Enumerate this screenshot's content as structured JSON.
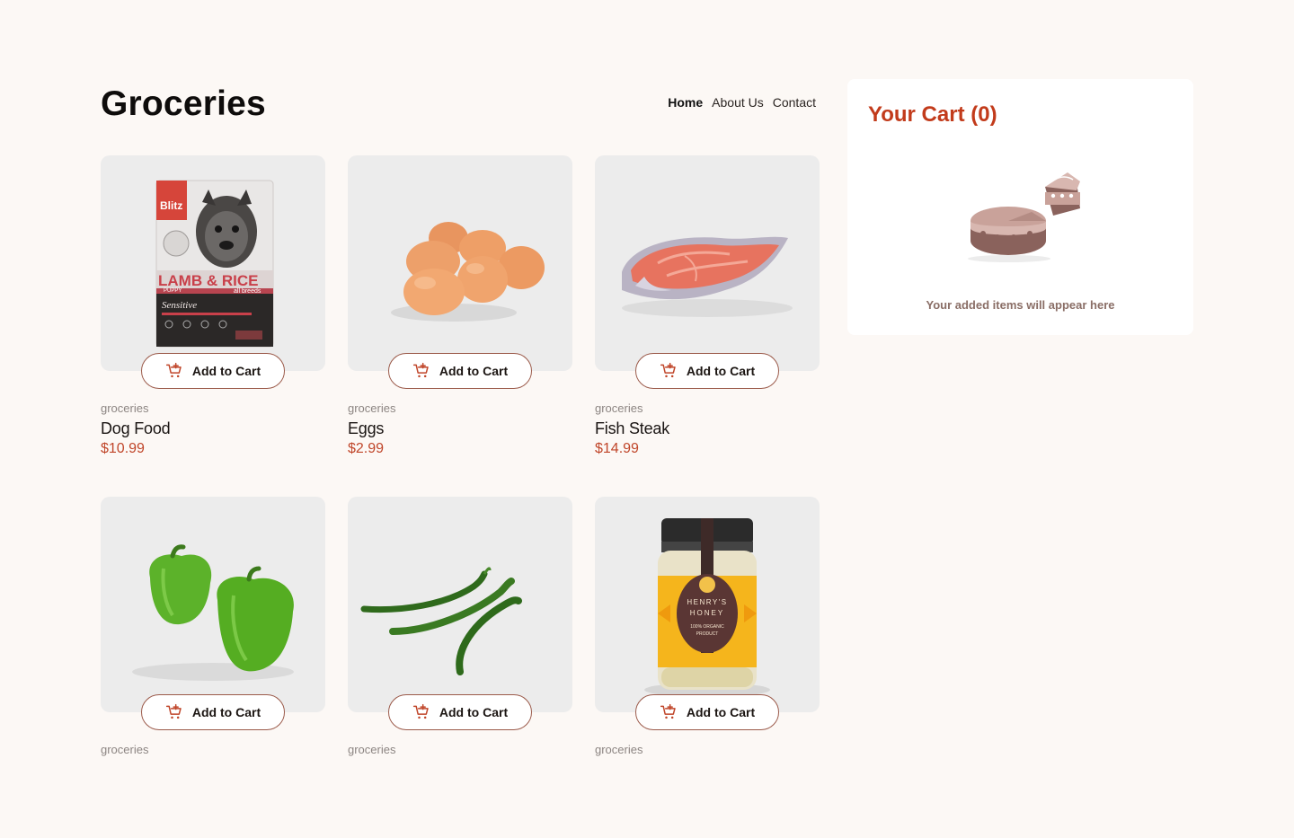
{
  "header": {
    "title": "Groceries",
    "nav": [
      {
        "label": "Home",
        "active": true
      },
      {
        "label": "About Us",
        "active": false
      },
      {
        "label": "Contact",
        "active": false
      }
    ]
  },
  "products": [
    {
      "category": "groceries",
      "name": "Dog Food",
      "price": "$10.99",
      "button": "Add to Cart",
      "image": "dog-food-bag"
    },
    {
      "category": "groceries",
      "name": "Eggs",
      "price": "$2.99",
      "button": "Add to Cart",
      "image": "eggs"
    },
    {
      "category": "groceries",
      "name": "Fish Steak",
      "price": "$14.99",
      "button": "Add to Cart",
      "image": "fish-steak"
    },
    {
      "category": "groceries",
      "name": "",
      "price": "",
      "button": "Add to Cart",
      "image": "green-peppers"
    },
    {
      "category": "groceries",
      "name": "",
      "price": "",
      "button": "Add to Cart",
      "image": "green-chillies"
    },
    {
      "category": "groceries",
      "name": "",
      "price": "",
      "button": "Add to Cart",
      "image": "honey-jar"
    }
  ],
  "dog_food_label": {
    "brand": "Blitz",
    "line1": "LAMB & RICE",
    "line2": "PUPPY",
    "line3": "all breeds",
    "line4": "Sensitive"
  },
  "honey_label": {
    "line1": "HENRY'S",
    "line2": "HONEY",
    "line3": "100% ORGANIC",
    "line4": "PRODUCT"
  },
  "cart": {
    "title": "Your Cart (0)",
    "empty_message": "Your added items will appear here"
  },
  "colors": {
    "background": "#fcf8f5",
    "accent": "#c23b1b",
    "price": "#c0462a",
    "card_bg": "#ececec"
  },
  "icons": {
    "add_to_cart": "cart-plus-icon",
    "cart_empty": "cake-illustration"
  }
}
